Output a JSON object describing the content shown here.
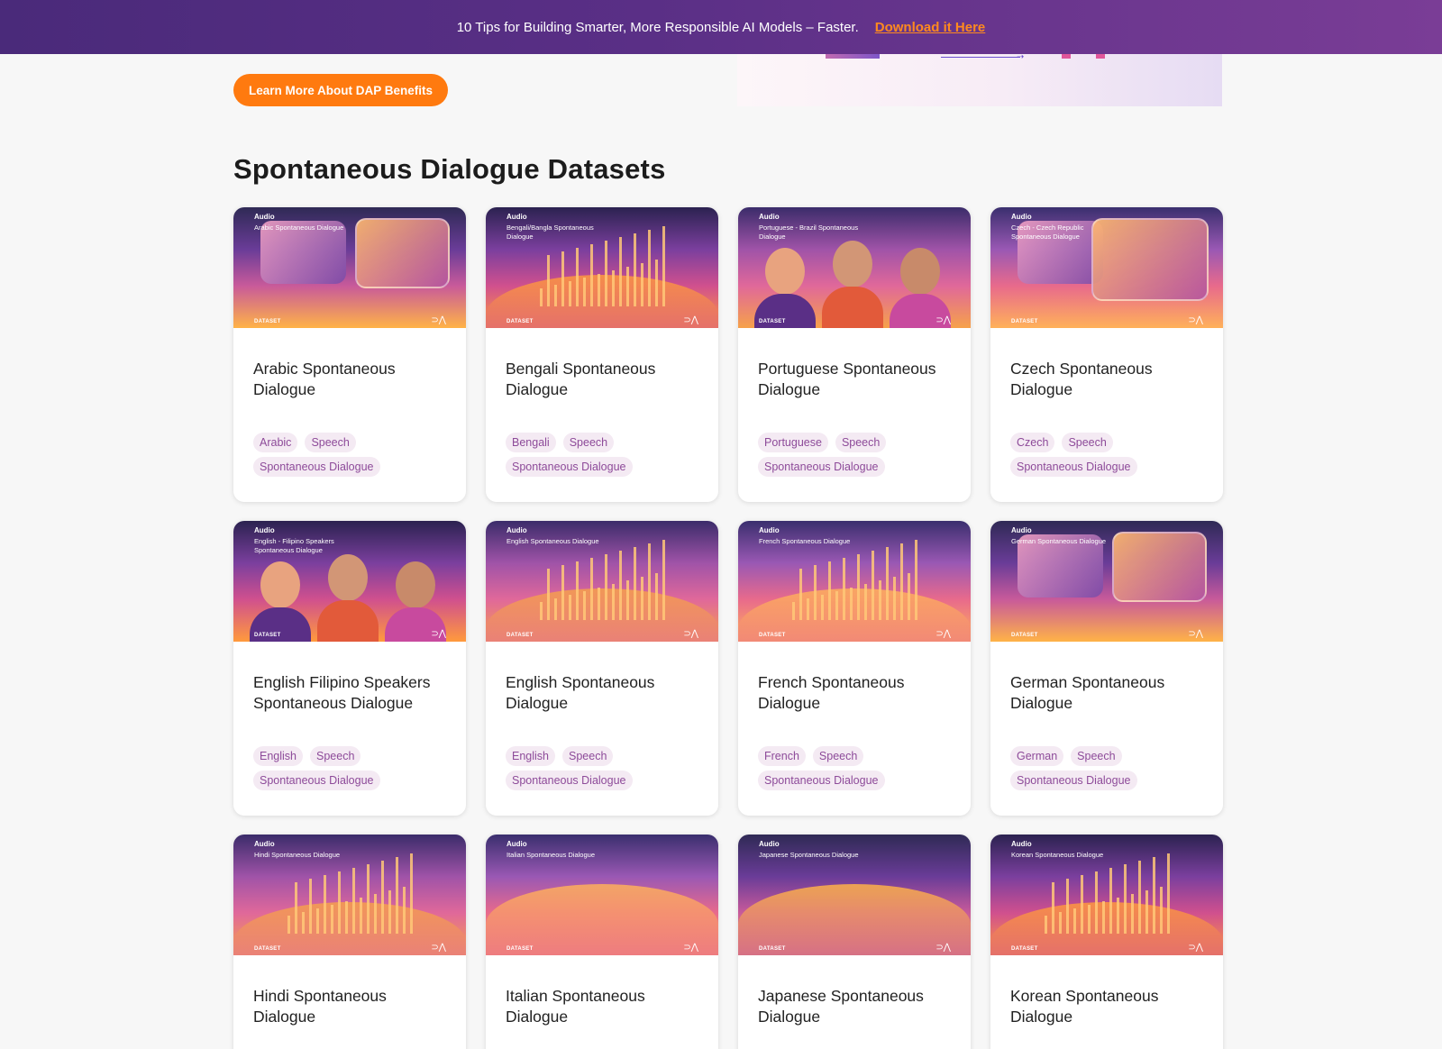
{
  "banner": {
    "text": "10 Tips for Building Smarter, More Responsible AI Models – Faster.",
    "link": "Download it Here"
  },
  "cta": {
    "label": "Learn More About DAP Benefits"
  },
  "section": {
    "title": "Spontaneous Dialogue Datasets"
  },
  "thumb_common": {
    "audio": "Audio",
    "dataset": "DATASET",
    "logo": "⊃⋀"
  },
  "cards": [
    {
      "thumb_text": "Arabic Spontaneous Dialogue",
      "title": "Arabic Spontaneous Dialogue",
      "tags": [
        "Arabic",
        "Speech",
        "Spontaneous Dialogue"
      ],
      "theme": "bubbles"
    },
    {
      "thumb_text": "Bengali/Bangla Spontaneous Dialogue",
      "title": "Bengali Spontaneous Dialogue",
      "tags": [
        "Bengali",
        "Speech",
        "Spontaneous Dialogue"
      ],
      "theme": "waves"
    },
    {
      "thumb_text": "Portuguese - Brazil Spontaneous Dialogue",
      "title": "Portuguese Spontaneous Dialogue",
      "tags": [
        "Portuguese",
        "Speech",
        "Spontaneous Dialogue"
      ],
      "theme": "people"
    },
    {
      "thumb_text": "Czech - Czech Republic Spontaneous Dialogue",
      "title": "Czech Spontaneous Dialogue",
      "tags": [
        "Czech",
        "Speech",
        "Spontaneous Dialogue"
      ],
      "theme": "bubble"
    },
    {
      "thumb_text": "English - Filipino Speakers Spontaneous Dialogue",
      "title": "English Filipino Speakers Spontaneous Dialogue",
      "tags": [
        "English",
        "Speech",
        "Spontaneous Dialogue"
      ],
      "theme": "people"
    },
    {
      "thumb_text": "English Spontaneous Dialogue",
      "title": "English Spontaneous Dialogue",
      "tags": [
        "English",
        "Speech",
        "Spontaneous Dialogue"
      ],
      "theme": "waves"
    },
    {
      "thumb_text": "French Spontaneous Dialogue",
      "title": "French Spontaneous Dialogue",
      "tags": [
        "French",
        "Speech",
        "Spontaneous Dialogue"
      ],
      "theme": "waves"
    },
    {
      "thumb_text": "German Spontaneous Dialogue",
      "title": "German Spontaneous Dialogue",
      "tags": [
        "German",
        "Speech",
        "Spontaneous Dialogue"
      ],
      "theme": "bubbles"
    },
    {
      "thumb_text": "Hindi Spontaneous Dialogue",
      "title": "Hindi Spontaneous Dialogue",
      "tags": [],
      "theme": "waves"
    },
    {
      "thumb_text": "Italian Spontaneous Dialogue",
      "title": "Italian Spontaneous Dialogue",
      "tags": [],
      "theme": "hills"
    },
    {
      "thumb_text": "Japanese Spontaneous Dialogue",
      "title": "Japanese Spontaneous Dialogue",
      "tags": [],
      "theme": "hills"
    },
    {
      "thumb_text": "Korean Spontaneous Dialogue",
      "title": "Korean Spontaneous Dialogue",
      "tags": [],
      "theme": "waves"
    }
  ]
}
